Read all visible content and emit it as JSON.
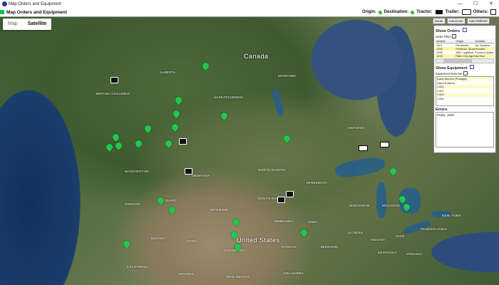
{
  "window": {
    "title": "Map Orders and Equipment",
    "controls": [
      "—",
      "☐",
      "✕"
    ]
  },
  "toolbar": {
    "app_name": "Map Orders and Equipment"
  },
  "legend": {
    "origin": "Origin:",
    "destination": "Destination:",
    "tractor": "Tractor:",
    "trailer": "Trailer:",
    "others": "Others:"
  },
  "map": {
    "tabs": [
      {
        "label": "Map"
      },
      {
        "label": "Satellite"
      }
    ],
    "labels": {
      "canada": "Canada",
      "united_states": "United States",
      "alberta": "ALBERTA",
      "british_columbia": "BRITISH COLUMBIA",
      "saskatchewan": "SASKATCHEWAN",
      "manitoba": "MANITOBA",
      "ontario": "ONTARIO",
      "quebec": "QUEBEC",
      "washington": "WASHINGTON",
      "oregon": "OREGON",
      "idaho": "IDAHO",
      "montana": "MONTANA",
      "north_dakota": "NORTH DAKOTA",
      "south_dakota": "SOUTH DAKOTA",
      "minnesota": "MINNESOTA",
      "wisconsin": "WISCONSIN",
      "iowa": "IOWA",
      "nebraska": "NEBRASKA",
      "michigan": "MICHIGAN",
      "wyoming": "WYOMING",
      "nevada": "NEVADA",
      "utah": "UTAH",
      "colorado": "COLORADO",
      "kansas": "KANSAS",
      "missouri": "MISSOURI",
      "illinois": "ILLINOIS",
      "indiana": "INDIANA",
      "ohio": "OHIO",
      "new_york": "NEW YORK",
      "pennsylvania": "PENNSYLVANIA",
      "california": "CALIFORNIA",
      "oklahoma": "OKLAHOMA",
      "new_mexico": "NEW MEXICO",
      "arizona": "ARIZONA",
      "kentucky": "KENTUCKY",
      "virginia": "VIRGINIA"
    }
  },
  "panel": {
    "buttons": {
      "zoom": "Zoom",
      "autozoom": "Autozoom",
      "auto_refresh": "Auto Refresh"
    },
    "orders": {
      "title": "Show Orders",
      "subtitle": "Order Filter",
      "columns": [
        "Order#",
        "Origin",
        "Destina"
      ],
      "rows": [
        {
          "order": "1107",
          "origin": "Pembroke",
          "dest": "Mr. Dealers"
        },
        {
          "order": "1203",
          "origin": "Fertisure \"Dune",
          "dest": "Pioneer"
        },
        {
          "order": "1205",
          "origin": "ABC Logistics",
          "dest": "Forest Lumber"
        },
        {
          "order": "1210",
          "origin": "Palm City Agr/Hype",
          "dest": "Ad Hoc"
        }
      ]
    },
    "equipment": {
      "title": "Show Equipment",
      "subtitle": "Equipment Data Set",
      "items": [
        "Dana Moreno (Portage)",
        "Dana Roberts",
        "C401",
        "C402",
        "C403",
        "C404"
      ]
    },
    "errors": {
      "title": "Errors",
      "lines": [
        "Order: 1920"
      ]
    }
  }
}
